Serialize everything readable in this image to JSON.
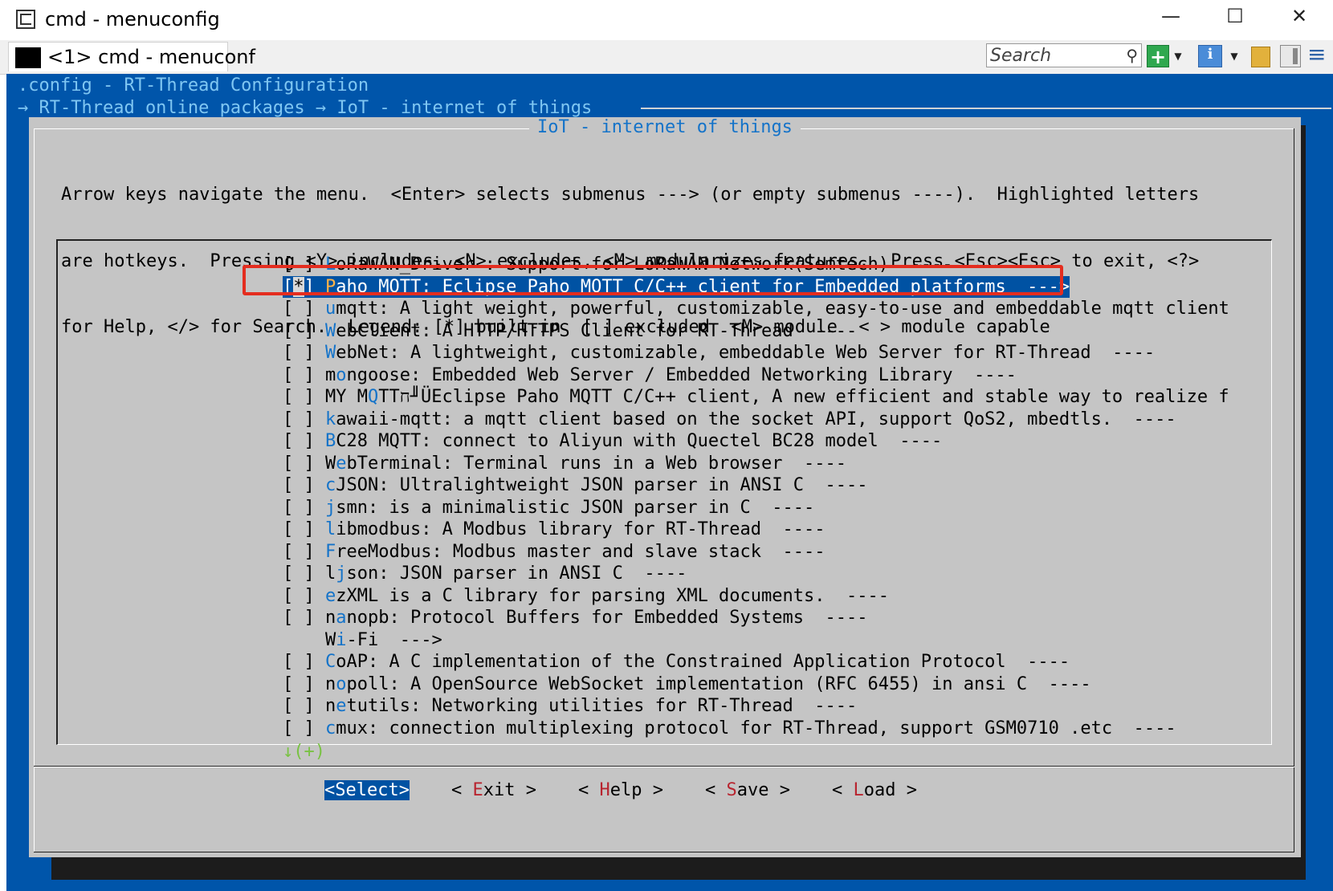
{
  "window": {
    "title": "cmd - menuconfig",
    "minimize_glyph": "—",
    "maximize_glyph": "☐",
    "close_glyph": "✕"
  },
  "tabbar": {
    "tab_label": "<1> cmd - menuconf",
    "search_placeholder": "Search",
    "search_icon_glyph": "⚲",
    "plus_glyph": "+",
    "dropdown_glyph": "▼",
    "info_glyph": "i",
    "menu_glyph": "≡"
  },
  "console": {
    "header1": ".config - RT-Thread Configuration",
    "header2": "→ RT-Thread online packages → IoT - internet of things",
    "dialog_title": "IoT - internet of things",
    "help_lines": [
      "Arrow keys navigate the menu.  <Enter> selects submenus ---> (or empty submenus ----).  Highlighted letters",
      "are hotkeys.  Pressing <Y> includes, <N> excludes, <M> modularizes features.  Press <Esc><Esc> to exit, <?>",
      "for Help, </> for Search.  Legend: [*] built-in  [ ] excluded  <M> module  < > module capable"
    ],
    "items": [
      {
        "prefix": "[ ] ",
        "hot": "L",
        "rest": "oRaWAN_Driver : Support for LoRaWAN Network(Semtech)  ----"
      },
      {
        "prefix": "[*] ",
        "hot": "P",
        "rest": "aho MQTT: Eclipse Paho MQTT C/C++ client for Embedded platforms  --->",
        "selected": true
      },
      {
        "prefix": "[ ] ",
        "hot": "u",
        "rest": "mqtt: A light weight, powerful, customizable, easy-to-use and embeddable mqtt client"
      },
      {
        "prefix": "[ ] ",
        "hot": "W",
        "rest": "ebClient: A HTTP/HTTPS Client for RT-Thread  ----"
      },
      {
        "prefix": "[ ] ",
        "hot": "W",
        "rest": "ebNet: A lightweight, customizable, embeddable Web Server for RT-Thread  ----"
      },
      {
        "prefix": "[ ] ",
        "pre": "m",
        "hot": "o",
        "rest": "ngoose: Embedded Web Server / Embedded Networking Library  ----"
      },
      {
        "prefix": "[ ] ",
        "pre": "MY M",
        "hot": "Q",
        "rest": "TTח╜ÜEclipse Paho MQTT C/C++ client, A new efficient and stable way to realize f"
      },
      {
        "prefix": "[ ] ",
        "hot": "k",
        "rest": "awaii-mqtt: a mqtt client based on the socket API, support QoS2, mbedtls.  ----"
      },
      {
        "prefix": "[ ] ",
        "hot": "B",
        "rest": "C28 MQTT: connect to Aliyun with Quectel BC28 model  ----"
      },
      {
        "prefix": "[ ] ",
        "pre": "W",
        "hot": "e",
        "rest": "bTerminal: Terminal runs in a Web browser  ----"
      },
      {
        "prefix": "[ ] ",
        "hot": "c",
        "rest": "JSON: Ultralightweight JSON parser in ANSI C  ----"
      },
      {
        "prefix": "[ ] ",
        "hot": "j",
        "rest": "smn: is a minimalistic JSON parser in C  ----"
      },
      {
        "prefix": "[ ] ",
        "hot": "l",
        "rest": "ibmodbus: A Modbus library for RT-Thread  ----"
      },
      {
        "prefix": "[ ] ",
        "hot": "F",
        "rest": "reeModbus: Modbus master and slave stack  ----"
      },
      {
        "prefix": "[ ] ",
        "pre": "l",
        "hot": "j",
        "rest": "son: JSON parser in ANSI C  ----"
      },
      {
        "prefix": "[ ] ",
        "hot": "e",
        "rest": "zXML is a C library for parsing XML documents.  ----"
      },
      {
        "prefix": "[ ] ",
        "pre": "n",
        "hot": "a",
        "rest": "nopb: Protocol Buffers for Embedded Systems  ----"
      },
      {
        "prefix": "    ",
        "pre": "W",
        "hot": "i",
        "rest": "-Fi  --->"
      },
      {
        "prefix": "[ ] ",
        "hot": "C",
        "rest": "oAP: A C implementation of the Constrained Application Protocol  ----"
      },
      {
        "prefix": "[ ] ",
        "pre": "n",
        "hot": "o",
        "rest": "poll: A OpenSource WebSocket implementation (RFC 6455) in ansi C  ----"
      },
      {
        "prefix": "[ ] ",
        "pre": "n",
        "hot": "e",
        "rest": "tutils: Networking utilities for RT-Thread  ----"
      },
      {
        "prefix": "[ ] ",
        "hot": "c",
        "rest": "mux: connection multiplexing protocol for RT-Thread, support GSM0710 .etc  ----"
      }
    ],
    "more_indicator": "↓(+)",
    "buttons": [
      {
        "open": "<",
        "key": "S",
        "rest": "elect",
        "close": ">",
        "active": true
      },
      {
        "open": "< ",
        "key": "E",
        "rest": "xit",
        "close": " >"
      },
      {
        "open": "< ",
        "key": "H",
        "rest": "elp",
        "close": " >"
      },
      {
        "open": "< ",
        "key": "S",
        "rest": "ave",
        "close": " >"
      },
      {
        "open": "< ",
        "key": "L",
        "rest": "oad",
        "close": " >"
      }
    ]
  }
}
